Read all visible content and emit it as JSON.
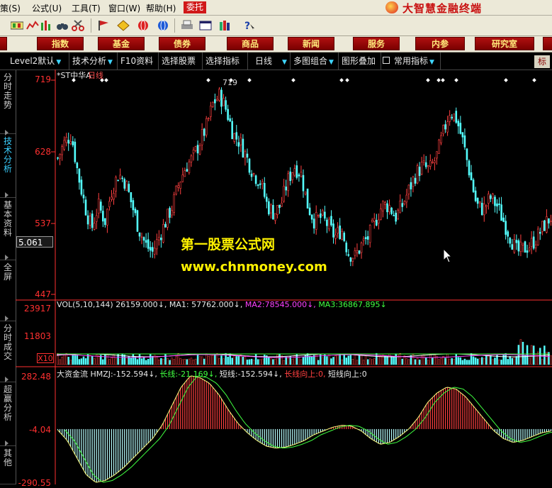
{
  "menubar": {
    "items": [
      "策(S)",
      "公式(U)",
      "工具(T)",
      "窗口(W)",
      "帮助(H)"
    ],
    "entrust": "委托",
    "brand": "大智慧金融终端"
  },
  "toolbar": {
    "icons": [
      "chart-grid-icon",
      "line-chart-icon",
      "bar-chart-icon",
      "binoculars-icon",
      "scissors-icon",
      "flag-icon",
      "diamond-icon",
      "globe-red-icon",
      "globe-blue-icon",
      "printer-icon",
      "window-icon",
      "books-icon",
      "help-icon"
    ]
  },
  "categories": [
    "股",
    "指数",
    "基金",
    "债券",
    "商品",
    "新闻",
    "服务",
    "内参",
    "研究室"
  ],
  "toolrow": {
    "items": [
      {
        "label": "Level2默认",
        "menu": true
      },
      {
        "label": "技术分析",
        "menu": true
      },
      {
        "label": "F10资料",
        "menu": false
      },
      {
        "label": "选择股票",
        "menu": false
      },
      {
        "label": "选择指标",
        "menu": false
      },
      {
        "label": "日线",
        "menu": true
      },
      {
        "label": "多图组合",
        "menu": true
      },
      {
        "label": "图形叠加",
        "menu": false
      },
      {
        "label": "常用指标",
        "menu": true
      }
    ],
    "right_button": "标"
  },
  "left_tabs": [
    "分时走势",
    "技术分析",
    "基本资料",
    "全屏",
    "分时成交",
    "超赢分析",
    "其他"
  ],
  "price_panel": {
    "stock": "*ST中华A",
    "period": "日线",
    "y_ticks": [
      "719",
      "628",
      "537",
      "447"
    ],
    "current_price": "5.061",
    "peak_marker": "719",
    "y_max": 719,
    "y_min": 447
  },
  "volume_panel": {
    "header": "VOL(5,10,144)",
    "vol_value": "26159.000",
    "ma1_label": "MA1:",
    "ma1_value": "57762.000",
    "ma2_label": "MA2:",
    "ma2_value": "78545.000",
    "ma3_label": "MA3:",
    "ma3_value": "36867.895",
    "y_ticks": [
      "23917",
      "11803"
    ],
    "unit_box": "X10"
  },
  "indicator_panel": {
    "name": "大资金流",
    "hmzj_label": "HMZJ:",
    "hmzj_value": "-152.594",
    "long_label": "长线:",
    "long_value": "-21.169",
    "short_label": "短线:",
    "short_value": "-152.594",
    "long_up_label": "长线向上:",
    "long_up_value": "0,",
    "short_up_label": "短线向上:",
    "short_up_value": "0",
    "y_ticks": [
      "282.48",
      "-4.04",
      "-290.55"
    ]
  },
  "watermark": {
    "line1": "第一股票公式网",
    "line2": "www.chnmoney.com"
  },
  "colors": {
    "up": "#ff4040",
    "down": "#54ffff",
    "ma1": "#ffffff",
    "ma2": "#ff40ff",
    "ma3": "#40ff40",
    "axis": "#ff3030"
  },
  "chart_data": {
    "type": "candlestick",
    "price": [
      620,
      640,
      650,
      600,
      560,
      530,
      560,
      540,
      580,
      600,
      590,
      560,
      530,
      510,
      500,
      520,
      540,
      560,
      590,
      610,
      620,
      640,
      660,
      690,
      700,
      680,
      650,
      640,
      620,
      600,
      590,
      560,
      550,
      560,
      590,
      610,
      600,
      560,
      540,
      545,
      535,
      520,
      530,
      500,
      495,
      510,
      520,
      540,
      560,
      560,
      545,
      560,
      580,
      600,
      610,
      605,
      620,
      650,
      680,
      670,
      640,
      600,
      560,
      555,
      570,
      560,
      540,
      520,
      500,
      505,
      510,
      520,
      535,
      545
    ],
    "flow": [
      -5,
      -60,
      -150,
      -240,
      -280,
      -270,
      -240,
      -200,
      -150,
      -100,
      -50,
      20,
      120,
      220,
      280,
      270,
      240,
      180,
      100,
      30,
      -20,
      -60,
      -90,
      -100,
      -95,
      -80,
      -60,
      -30,
      -10,
      10,
      20,
      15,
      -10,
      -50,
      -80,
      -70,
      -40,
      0,
      60,
      140,
      190,
      220,
      210,
      170,
      110,
      50,
      -10,
      -50,
      -70,
      -60,
      -40,
      -20,
      -10
    ]
  }
}
